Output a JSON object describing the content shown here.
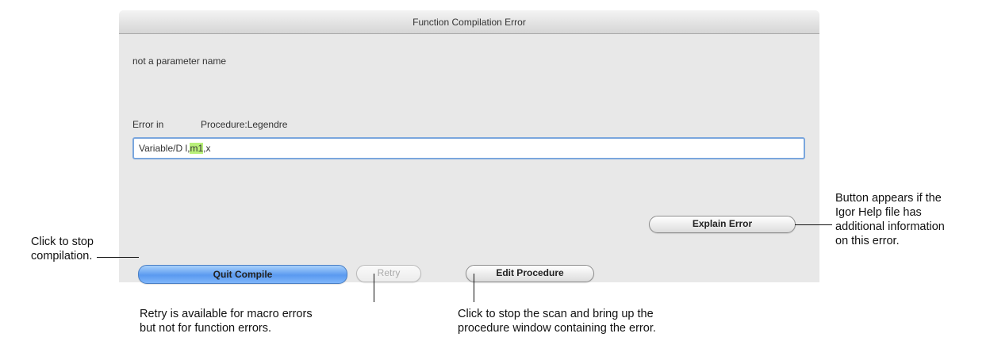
{
  "dialog": {
    "title": "Function Compilation Error",
    "message": "not a parameter name",
    "error_label": "Error in",
    "procedure": "Procedure:Legendre",
    "code_prefix": "Variable/D l,",
    "code_highlight": "m1",
    "code_suffix": ",x",
    "buttons": {
      "quit": "Quit Compile",
      "retry": "Retry",
      "edit": "Edit Procedure",
      "explain": "Explain Error"
    }
  },
  "annotations": {
    "quit_line1": "Click to stop",
    "quit_line2": "compilation.",
    "retry_line1": "Retry is available for macro errors",
    "retry_line2": "but not for function errors.",
    "edit_line1": "Click to stop the scan and bring up the",
    "edit_line2": "procedure window containing the error.",
    "explain_line1": "Button appears if the",
    "explain_line2": "Igor Help file has",
    "explain_line3": "additional information",
    "explain_line4": "on this error."
  },
  "colors": {
    "highlight": "#b9f07a",
    "focus_ring": "#7aa6dd",
    "default_button": "#5a9af0"
  }
}
